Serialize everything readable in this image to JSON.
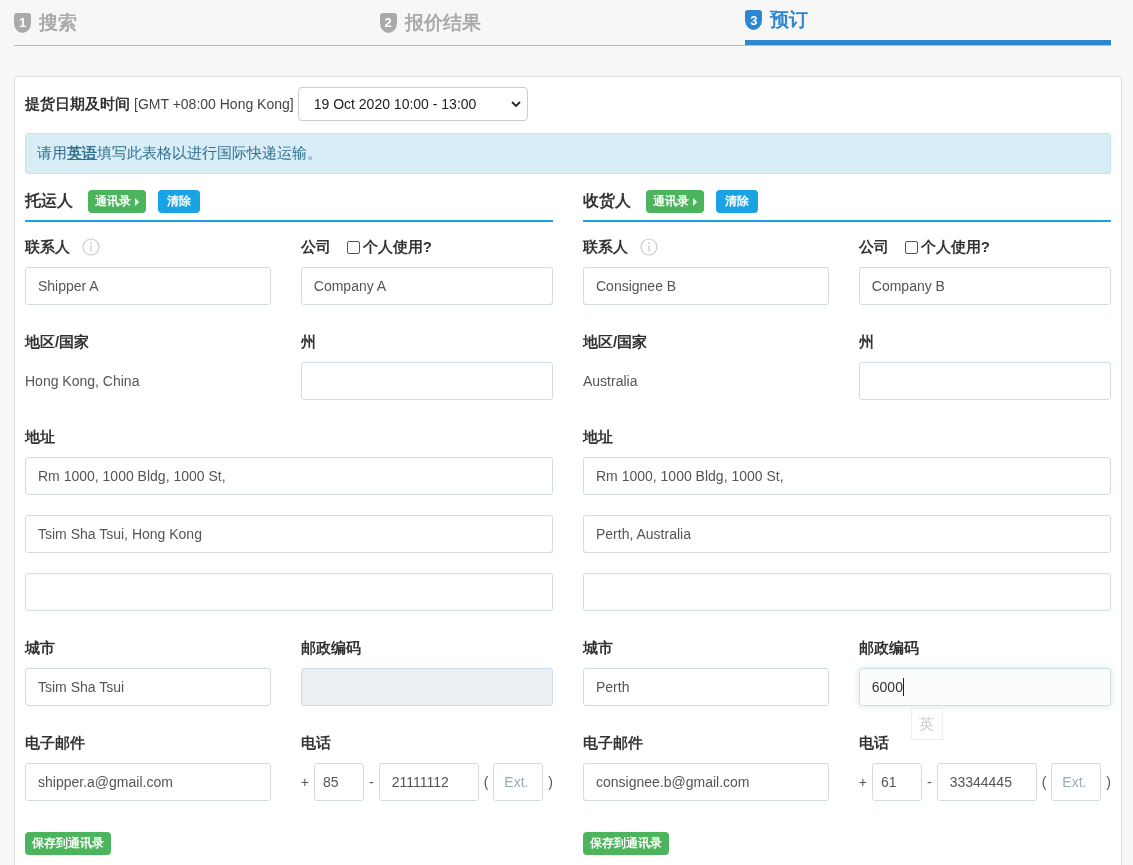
{
  "steps": [
    {
      "number": "1",
      "label": "搜索",
      "selected": false
    },
    {
      "number": "2",
      "label": "报价结果",
      "selected": false
    },
    {
      "number": "3",
      "label": "预订",
      "selected": true
    }
  ],
  "pickup": {
    "label": "提货日期及时间",
    "timezone": "[GMT +08:00 Hong Kong]",
    "value": "19 Oct 2020 10:00 - 13:00"
  },
  "notice": "请用**英语**填写此表格以进行国际快递运输。",
  "parties": [
    {
      "title": "托运人",
      "address_book_button": "通讯录",
      "clear_button": "清除",
      "contact_label": "联系人",
      "contact_value": "Shipper A",
      "company_label": "公司",
      "personal_use": {
        "label": "个人使用?",
        "checked": false
      },
      "company_value": "Company A",
      "country_label": "地区/国家",
      "country_value": "Hong Kong, China",
      "state_label": "州",
      "address_label": "地址",
      "address_lines": [
        {
          "kind": "filled",
          "value": "Rm 1000, 1000 Bldg, 1000 St,"
        },
        {
          "kind": "filled",
          "value": "Tsim Sha Tsui, Hong Kong"
        },
        {
          "kind": "blank"
        }
      ],
      "city_label": "城市",
      "city_value": "Tsim Sha Tsui",
      "postal_label": "邮政编码",
      "postal": {
        "disabled": true,
        "focused": false
      },
      "email_label": "电子邮件",
      "email_value": "shipper.a@gmail.com",
      "phone_label": "电话",
      "phone_plus": "+",
      "phone_code": "85",
      "phone_dash": "-",
      "phone_number": "21111112",
      "ext_open": "(",
      "ext_placeholder": "Ext.",
      "ext_close": ")",
      "save_button": "保存到通讯录"
    },
    {
      "title": "收货人",
      "address_book_button": "通讯录",
      "clear_button": "清除",
      "contact_label": "联系人",
      "contact_value": "Consignee B",
      "company_label": "公司",
      "personal_use": {
        "label": "个人使用?",
        "checked": false
      },
      "company_value": "Company B",
      "country_label": "地区/国家",
      "country_value": "Australia",
      "state_label": "州",
      "address_label": "地址",
      "address_lines": [
        {
          "kind": "filled",
          "value": "Rm 1000, 1000 Bldg, 1000 St,"
        },
        {
          "kind": "filled",
          "value": "Perth, Australia"
        },
        {
          "kind": "blank"
        }
      ],
      "city_label": "城市",
      "city_value": "Perth",
      "postal_label": "邮政编码",
      "postal": {
        "disabled": false,
        "focused": true,
        "value": "6000",
        "ime_indicator": "英"
      },
      "email_label": "电子邮件",
      "email_value": "consignee.b@gmail.com",
      "phone_label": "电话",
      "phone_plus": "+",
      "phone_code": "61",
      "phone_dash": "-",
      "phone_number": "33344445",
      "ext_open": "(",
      "ext_placeholder": "Ext.",
      "ext_close": ")",
      "save_button": "保存到通讯录"
    }
  ]
}
